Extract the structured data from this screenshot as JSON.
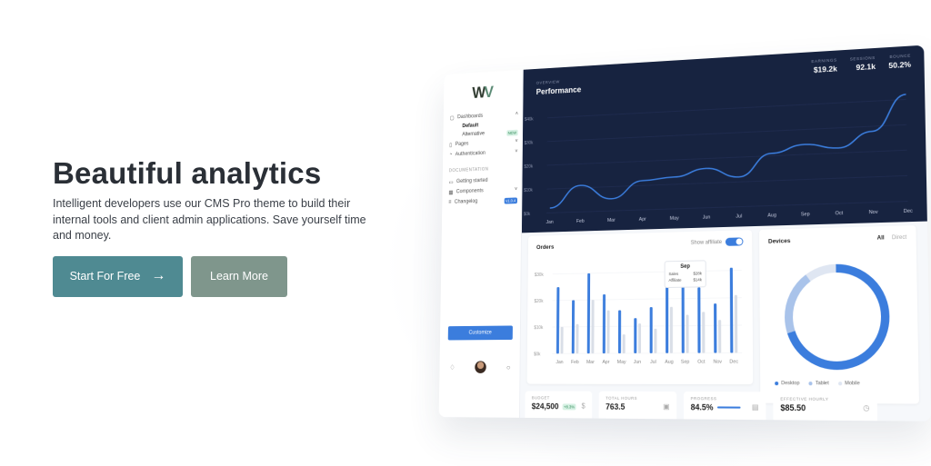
{
  "hero": {
    "title": "Beautiful analytics",
    "subtitle": "Intelligent developers use our CMS Pro theme to build their internal tools and client admin applications. Save yourself time and money.",
    "primary_button": "Start For Free",
    "secondary_button": "Learn More"
  },
  "sidebar": {
    "items": [
      {
        "label": "Dashboards",
        "icon": "dashboard-icon"
      },
      {
        "label": "Default",
        "sub": true,
        "active": true
      },
      {
        "label": "Alternative",
        "sub": true,
        "badge": "NEW"
      },
      {
        "label": "Pages",
        "icon": "page-icon"
      },
      {
        "label": "Authentication",
        "icon": "user-icon"
      }
    ],
    "section_header": "DOCUMENTATION",
    "doc_items": [
      {
        "label": "Getting started",
        "icon": "book-icon"
      },
      {
        "label": "Components",
        "icon": "grid-icon"
      },
      {
        "label": "Changelog",
        "icon": "list-icon",
        "badge": "v1.0.4"
      }
    ],
    "customize_label": "Customize"
  },
  "performance": {
    "overline": "OVERVIEW",
    "title": "Performance",
    "stats": [
      {
        "label": "EARNINGS",
        "value": "$19.2k"
      },
      {
        "label": "SESSIONS",
        "value": "92.1k"
      },
      {
        "label": "BOUNCE",
        "value": "50.2%"
      }
    ]
  },
  "orders": {
    "title": "Orders",
    "toggle_label": "Show affiliate",
    "tooltip": {
      "month": "Sep",
      "sales_label": "Sales",
      "sales_value": "$28k",
      "affiliate_label": "Affiliate",
      "affiliate_value": "$14k"
    }
  },
  "devices": {
    "title": "Devices",
    "tabs": [
      "All",
      "Direct"
    ],
    "legend": [
      "Desktop",
      "Tablet",
      "Mobile"
    ]
  },
  "kpis": [
    {
      "label": "BUDGET",
      "value": "$24,500",
      "badge": "+8.3%",
      "icon": "dollar-icon"
    },
    {
      "label": "TOTAL HOURS",
      "value": "763.5",
      "icon": "briefcase-icon"
    },
    {
      "label": "PROGRESS",
      "value": "84.5%",
      "icon": "clipboard-icon",
      "progress": 0.845
    },
    {
      "label": "EFFECTIVE HOURLY",
      "value": "$85.50",
      "icon": "clock-icon"
    }
  ],
  "colors": {
    "primary_button": "#4f8a92",
    "secondary_button": "#7f968c",
    "navy": "#172340",
    "accent_blue": "#3b7ddd"
  },
  "chart_data": [
    {
      "type": "line",
      "x": [
        "Jan",
        "Feb",
        "Mar",
        "Apr",
        "May",
        "Jun",
        "Jul",
        "Aug",
        "Sep",
        "Oct",
        "Nov",
        "Dec"
      ],
      "yticks": [
        "$0k",
        "$10k",
        "$20k",
        "$30k",
        "$40k"
      ],
      "ylim": [
        0,
        40
      ],
      "series": [
        {
          "values": [
            2,
            11,
            5,
            12,
            13,
            16,
            12,
            21,
            24,
            22,
            28,
            42
          ]
        }
      ]
    },
    {
      "type": "bar",
      "categories": [
        "Jan",
        "Feb",
        "Mar",
        "Apr",
        "May",
        "Jun",
        "Jul",
        "Aug",
        "Sep",
        "Oct",
        "Nov",
        "Dec"
      ],
      "yticks": [
        "$0k",
        "$10k",
        "$20k",
        "$30k"
      ],
      "ylim": [
        0,
        30
      ],
      "series": [
        {
          "name": "Sales",
          "values": [
            25,
            20,
            30,
            22,
            16,
            13,
            17,
            26,
            28,
            24,
            18,
            31
          ]
        },
        {
          "name": "Affiliate",
          "values": [
            10,
            11,
            20,
            16,
            7,
            11,
            9,
            17,
            14,
            15,
            12,
            21
          ]
        }
      ]
    },
    {
      "type": "pie",
      "categories": [
        "Desktop",
        "Tablet",
        "Mobile"
      ],
      "values": [
        70,
        20,
        10
      ]
    }
  ]
}
